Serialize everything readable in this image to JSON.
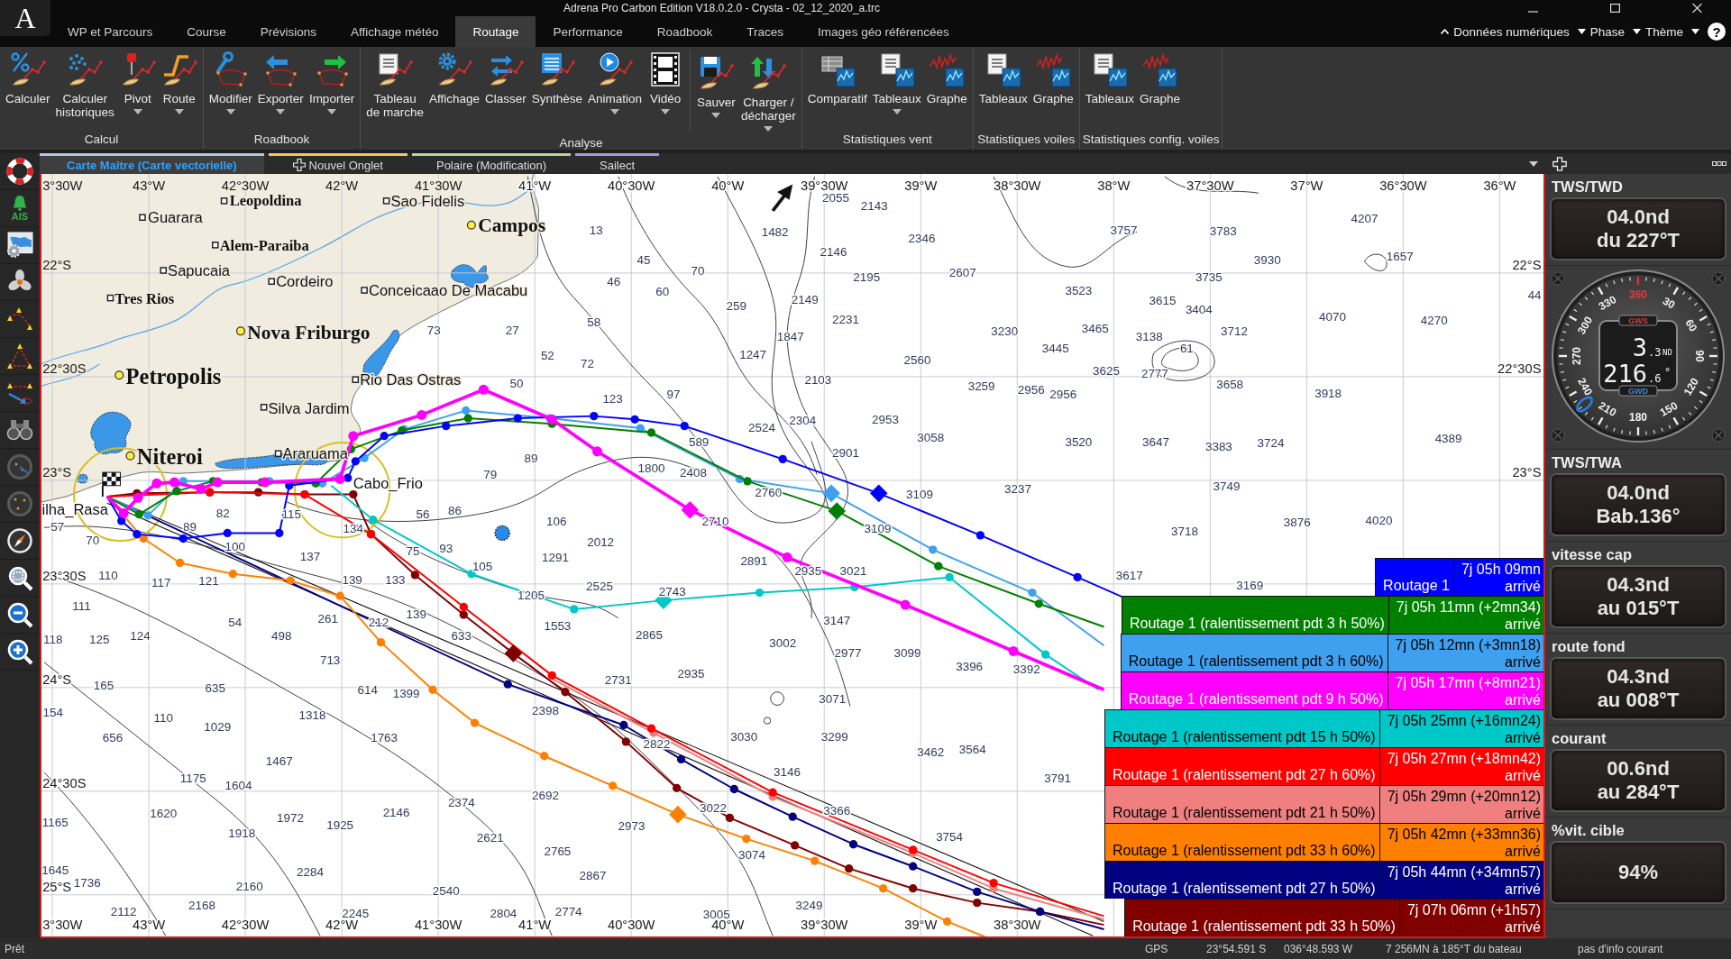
{
  "window": {
    "logo": "A",
    "title": "Adrena Pro Carbon Edition V18.0.2.0 - Crysta - 02_12_2020_a.trc"
  },
  "menu_tabs": [
    {
      "label": "WP et Parcours",
      "selected": false
    },
    {
      "label": "Course",
      "selected": false
    },
    {
      "label": "Prévisions",
      "selected": false
    },
    {
      "label": "Affichage météo",
      "selected": false
    },
    {
      "label": "Routage",
      "selected": true
    },
    {
      "label": "Performance",
      "selected": false
    },
    {
      "label": "Roadbook",
      "selected": false
    },
    {
      "label": "Traces",
      "selected": false
    },
    {
      "label": "Images géo référencées",
      "selected": false
    }
  ],
  "menu_right": {
    "items": [
      {
        "label": "Données numériques",
        "expanded": true
      },
      {
        "label": "Phase",
        "expanded": false
      },
      {
        "label": "Thème",
        "expanded": false
      }
    ],
    "help": "?"
  },
  "ribbon": {
    "groups": [
      {
        "label": "Calcul",
        "sections": [
          [
            {
              "label": "Calculer",
              "menu": false
            },
            {
              "label": "Calculer\nhistoriques",
              "menu": false
            },
            {
              "label": "Pivot",
              "menu": true
            },
            {
              "label": "Route",
              "menu": true
            }
          ]
        ]
      },
      {
        "label": "Roadbook",
        "sections": [
          [
            {
              "label": "Modifier",
              "menu": true
            },
            {
              "label": "Exporter",
              "menu": true
            },
            {
              "label": "Importer",
              "menu": true
            }
          ]
        ]
      },
      {
        "label": "Analyse",
        "sections": [
          [
            {
              "label": "Tableau\nde marche",
              "menu": false
            },
            {
              "label": "Affichage",
              "menu": false
            },
            {
              "label": "Classer",
              "menu": false
            },
            {
              "label": "Synthèse",
              "menu": false
            },
            {
              "label": "Animation",
              "menu": true
            },
            {
              "label": "Vidéo",
              "menu": true
            }
          ],
          [
            {
              "label": "Sauver",
              "menu": true
            },
            {
              "label": "Charger /\ndécharger",
              "menu": true
            }
          ]
        ]
      },
      {
        "label": "Statistiques vent",
        "sections": [
          [
            {
              "label": "Comparatif",
              "menu": false
            },
            {
              "label": "Tableaux",
              "menu": true
            },
            {
              "label": "Graphe",
              "menu": false
            }
          ]
        ]
      },
      {
        "label": "Statistiques voiles",
        "sections": [
          [
            {
              "label": "Tableaux",
              "menu": false
            },
            {
              "label": "Graphe",
              "menu": false
            }
          ]
        ]
      },
      {
        "label": "Statistiques config. voiles",
        "sections": [
          [
            {
              "label": "Tableaux",
              "menu": false
            },
            {
              "label": "Graphe",
              "menu": false
            }
          ]
        ]
      }
    ]
  },
  "doc_tabs": [
    {
      "label": "Carte Maître (Carte vectorielle)",
      "kind": "page",
      "selected": true,
      "color": "#b4c4e4"
    },
    {
      "label": "Nouvel Onglet",
      "kind": "add",
      "selected": false,
      "color": "#f0c860"
    },
    {
      "label": "Polaire (Modification)",
      "kind": "page",
      "selected": false,
      "color": "#b8d49c"
    },
    {
      "label": "Sailect",
      "kind": "page",
      "selected": false,
      "color": "#9c9ce0"
    }
  ],
  "left_toolbar": {
    "ais_label": "AIS"
  },
  "chart": {
    "top_longitudes": [
      "3°30W",
      "43°W",
      "42°30W",
      "42°W",
      "41°30W",
      "41°W",
      "40°30W",
      "40°W",
      "39°30W",
      "39°W",
      "38°30W",
      "38°W",
      "37°30W",
      "37°W",
      "36°30W",
      "36°W"
    ],
    "bottom_longitudes": [
      "3°30W",
      "43°W",
      "42°30W",
      "42°W",
      "41°30W",
      "41°W",
      "40°30W",
      "40°W",
      "39°30W",
      "39°W",
      "38°30W"
    ],
    "left_latitudes": [
      "22°S",
      "22°30S",
      "23°S",
      "23°30S",
      "24°S",
      "24°30S",
      "25°S"
    ],
    "right_latitudes": [
      "22°S",
      "22°30S",
      "23°S"
    ],
    "places": [
      {
        "name": "Leopoldina",
        "kind": "town"
      },
      {
        "name": "Sao Fidelis",
        "kind": "village"
      },
      {
        "name": "Campos",
        "kind": "city"
      },
      {
        "name": "Guarara",
        "kind": "village"
      },
      {
        "name": "Alem-Paraiba",
        "kind": "town"
      },
      {
        "name": "Sapucaia",
        "kind": "village"
      },
      {
        "name": "Cordeiro",
        "kind": "village"
      },
      {
        "name": "Conceicaao De Macabu",
        "kind": "village"
      },
      {
        "name": "Tres Rios",
        "kind": "town"
      },
      {
        "name": "Nova Friburgo",
        "kind": "city"
      },
      {
        "name": "Petropolis",
        "kind": "major-city"
      },
      {
        "name": "Rio Das Ostras",
        "kind": "village"
      },
      {
        "name": "Silva Jardim",
        "kind": "village"
      },
      {
        "name": "Niteroi",
        "kind": "major-city"
      },
      {
        "name": "Araruama",
        "kind": "village"
      },
      {
        "name": "Cabo_Frio",
        "kind": "locality"
      },
      {
        "name": "ilha_Rasa",
        "kind": "locality"
      }
    ],
    "soundings": [
      "13",
      "45",
      "70",
      "46",
      "60",
      "58",
      "73",
      "27",
      "52",
      "72",
      "50",
      "123",
      "97",
      "589",
      "89",
      "79",
      "1800",
      "2408",
      "56",
      "86",
      "106",
      "82",
      "115",
      "57",
      "70",
      "89",
      "100",
      "137",
      "134",
      "75",
      "93",
      "105",
      "2012",
      "1291",
      "2710",
      "2760",
      "2891",
      "2935",
      "2525",
      "2743",
      "1205",
      "1553",
      "2865",
      "110",
      "117",
      "121",
      "139",
      "133",
      "139",
      "111",
      "125",
      "124",
      "54",
      "498",
      "261",
      "212",
      "633",
      "713",
      "118",
      "165",
      "635",
      "614",
      "1399",
      "154",
      "110",
      "1029",
      "1318",
      "656",
      "1763",
      "2398",
      "2731",
      "2935",
      "1175",
      "1604",
      "1467",
      "1165",
      "1620",
      "1918",
      "1972",
      "1925",
      "2146",
      "2374",
      "2692",
      "2621",
      "2765",
      "2973",
      "3022",
      "3074",
      "3146",
      "3030",
      "2867",
      "2284",
      "2160",
      "2540",
      "1645",
      "1736",
      "2112",
      "2168",
      "2245",
      "2804",
      "2774",
      "3005",
      "3249",
      "3754",
      "3366",
      "3462",
      "3564",
      "3071",
      "3299",
      "3396",
      "3392",
      "3099",
      "2977",
      "3002",
      "3147",
      "3021",
      "3109",
      "3109",
      "3237",
      "2822",
      "1482",
      "2055",
      "2143",
      "2146",
      "2346",
      "2195",
      "2607",
      "2149",
      "1847",
      "2231",
      "1247",
      "2103",
      "259",
      "2524",
      "2304",
      "2953",
      "2901",
      "3058",
      "2560",
      "3230",
      "3259",
      "2956",
      "2956",
      "3445",
      "3465",
      "3523",
      "3757",
      "3783",
      "3735",
      "3930",
      "4207",
      "1657",
      "3615",
      "3404",
      "3712",
      "4070",
      "4270",
      "3138",
      "3625",
      "2777",
      "61",
      "3658",
      "3918",
      "3520",
      "3647",
      "3383",
      "3724",
      "4389",
      "3749",
      "3876",
      "4020",
      "3718",
      "3617",
      "3169",
      "3791",
      "44"
    ]
  },
  "routes": [
    {
      "name": "Routage 1",
      "eta": "7j 05h 09mn",
      "status": "arrivé",
      "color": "#0000ff"
    },
    {
      "name": "Routage 1 (ralentissement pdt 3 h 50%)",
      "eta": "7j 05h 11mn (+2mn34)",
      "status": "arrivé",
      "color": "#008000"
    },
    {
      "name": "Routage 1 (ralentissement pdt 3 h 60%)",
      "eta": "7j 05h 12mn (+3mn18)",
      "status": "arrivé",
      "color": "#40a0f0"
    },
    {
      "name": "Routage 1 (ralentissement pdt 9 h 50%)",
      "eta": "7j 05h 17mn (+8mn21)",
      "status": "arrivé",
      "color": "#ff00ff"
    },
    {
      "name": "Routage 1 (ralentissement pdt 15 h 50%)",
      "eta": "7j 05h 25mn (+16mn24)",
      "status": "arrivé",
      "color": "#00c8c8"
    },
    {
      "name": "Routage 1 (ralentissement pdt 27 h 60%)",
      "eta": "7j 05h 27mn (+18mn42)",
      "status": "arrivé",
      "color": "#ff0000"
    },
    {
      "name": "Routage 1 (ralentissement pdt 21 h 50%)",
      "eta": "7j 05h 29mn (+20mn12)",
      "status": "arrivé",
      "color": "#f08080"
    },
    {
      "name": "Routage 1 (ralentissement pdt 33 h 60%)",
      "eta": "7j 05h 42mn (+33mn36)",
      "status": "arrivé",
      "color": "#ff8000"
    },
    {
      "name": "Routage 1 (ralentissement pdt 27 h 50%)",
      "eta": "7j 05h 44mn (+34mn57)",
      "status": "arrivé",
      "color": "#000080"
    },
    {
      "name": "Routage 1 (ralentissement pdt 33 h 50%)",
      "eta": "7j 07h 06mn (+1h57)",
      "status": "arrivé",
      "color": "#800000"
    }
  ],
  "instruments": [
    {
      "kind": "readout",
      "title": "TWS/TWD",
      "lines": [
        "04.0nd",
        "du 227°T"
      ]
    },
    {
      "kind": "dial",
      "scale": [
        "360",
        "30",
        "60",
        "90",
        "120",
        "150",
        "180",
        "210",
        "240",
        "270",
        "300",
        "330"
      ],
      "top_label": "GWS",
      "speed": "3",
      "speed_decimal": ".3",
      "speed_unit": "ND",
      "direction": "216",
      "direction_decimal": ".6",
      "direction_unit": "°",
      "bottom_label": "GWD"
    },
    {
      "kind": "readout",
      "title": "TWS/TWA",
      "lines": [
        "04.0nd",
        "Bab.136°"
      ]
    },
    {
      "kind": "readout",
      "title": "vitesse cap",
      "lines": [
        "04.3nd",
        "au 015°T"
      ]
    },
    {
      "kind": "readout",
      "title": "route fond",
      "lines": [
        "04.3nd",
        "au 008°T"
      ]
    },
    {
      "kind": "readout",
      "title": "courant",
      "lines": [
        "00.6nd",
        "au 284°T"
      ]
    },
    {
      "kind": "readout",
      "title": "%vit. cible",
      "lines": [
        "94%"
      ]
    }
  ],
  "status_bar": {
    "state": "Prêt",
    "source": "GPS",
    "latitude": "23°54.591 S",
    "longitude": "036°48.593 W",
    "bearing": "7 256MN à 185°T du bateau",
    "current": "pas d'info courant"
  }
}
